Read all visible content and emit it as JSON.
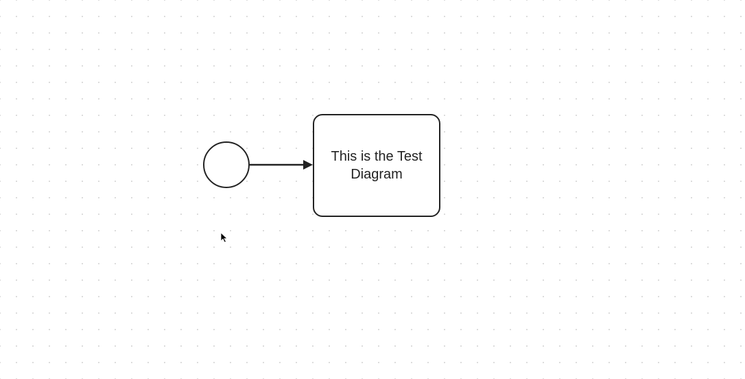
{
  "diagram": {
    "nodes": {
      "start_event": {
        "type": "start-event",
        "label": ""
      },
      "task": {
        "type": "task",
        "label": "This is the Test\nDiagram"
      }
    },
    "edges": [
      {
        "from": "start_event",
        "to": "task",
        "type": "sequence-flow"
      }
    ]
  },
  "colors": {
    "stroke": "#222222",
    "background": "#ffffff",
    "grid_dot": "#d0d0d0"
  }
}
